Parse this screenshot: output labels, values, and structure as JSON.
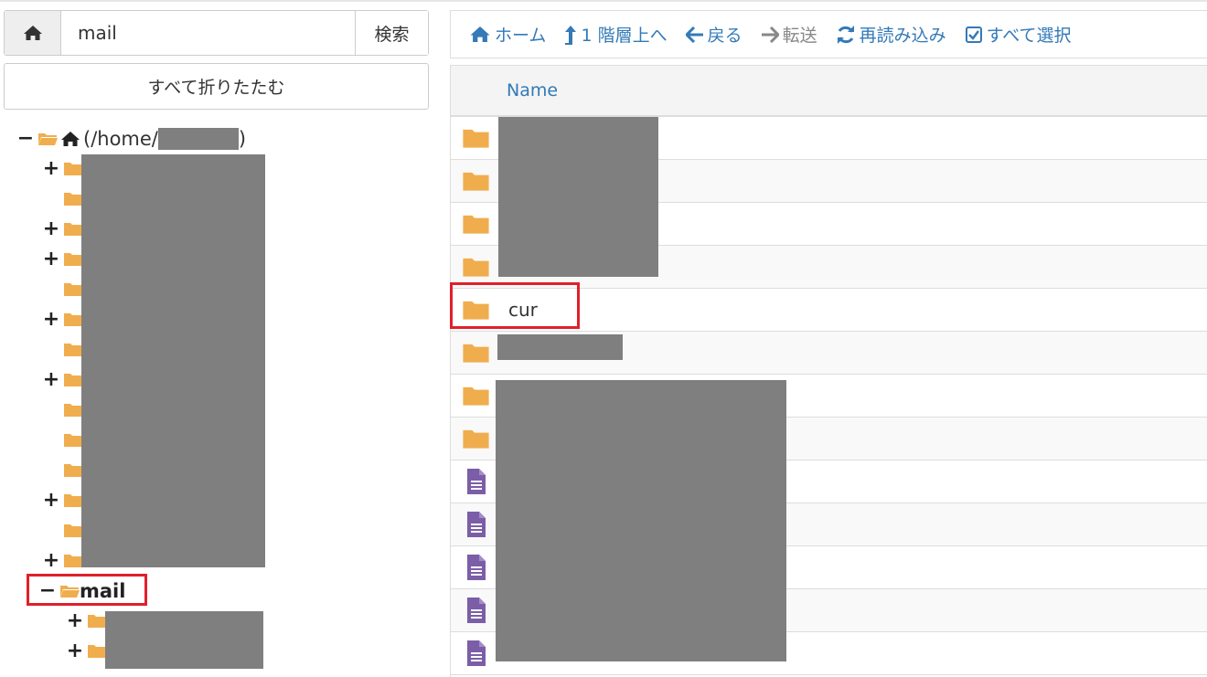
{
  "search": {
    "value": "mail",
    "button_label": "検索"
  },
  "collapse_all_label": "すべて折りたたむ",
  "tree": {
    "root_label": "(/home/",
    "root_close": ")",
    "mail_label": "mail"
  },
  "toolbar": {
    "home": "ホーム",
    "up": "1 階層上へ",
    "back": "戻る",
    "forward": "転送",
    "reload": "再読み込み",
    "select_all": "すべて選択"
  },
  "table": {
    "header_name": "Name",
    "visible_item_name": "cur"
  },
  "colors": {
    "folder": "#f0ad4e",
    "file": "#7b5ea7",
    "link": "#337ab7",
    "highlight": "#e0202a",
    "redaction": "#7f7f7f"
  }
}
